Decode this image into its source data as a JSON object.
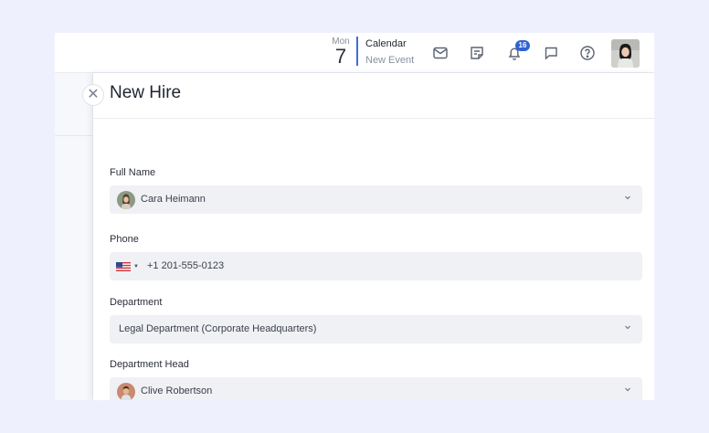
{
  "topbar": {
    "day_of_week": "Mon",
    "day_number": "7",
    "calendar_title": "Calendar",
    "calendar_sub": "New Event",
    "notification_count": "16",
    "icons": [
      "mail-icon",
      "notes-icon",
      "bell-icon",
      "chat-icon",
      "help-icon"
    ]
  },
  "panel": {
    "title": "New Hire",
    "close_glyph": "✕"
  },
  "form": {
    "full_name": {
      "label": "Full Name",
      "value": "Cara Heimann"
    },
    "phone": {
      "label": "Phone",
      "country": "US",
      "value": "+1 201-555-0123"
    },
    "department": {
      "label": "Department",
      "value": "Legal Department (Corporate Headquarters)"
    },
    "department_head": {
      "label": "Department Head",
      "value": "Clive Robertson"
    }
  },
  "colors": {
    "accent": "#2f63d4",
    "page_bg": "#eef1fd",
    "field_bg": "#f0f1f5"
  }
}
